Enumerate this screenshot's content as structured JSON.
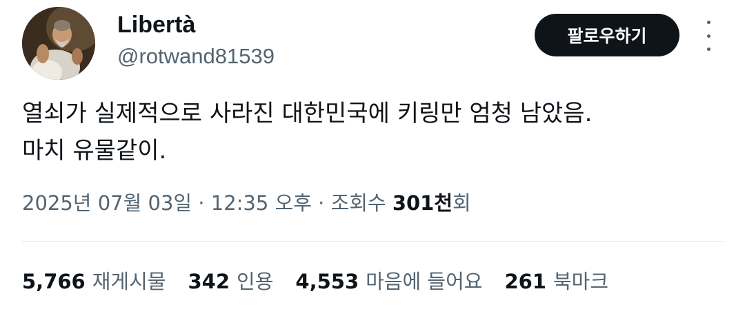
{
  "author": {
    "display_name": "Libertà",
    "handle": "@rotwand81539"
  },
  "actions": {
    "follow_label": "팔로우하기"
  },
  "tweet": {
    "text_lines": [
      "열쇠가 실제적으로 사라진 대한민국에 키링만 엄청 남았음.",
      "마치 유물같이."
    ]
  },
  "meta": {
    "date": "2025년 07월 03일",
    "separator": " · ",
    "time": "12:35 오후",
    "views_label": "조회수",
    "views_value": "301천",
    "views_suffix": "회"
  },
  "stats": [
    {
      "value": "5,766",
      "label": "재게시물"
    },
    {
      "value": "342",
      "label": "인용"
    },
    {
      "value": "4,553",
      "label": "마음에 들어요"
    },
    {
      "value": "261",
      "label": "북마크"
    }
  ]
}
